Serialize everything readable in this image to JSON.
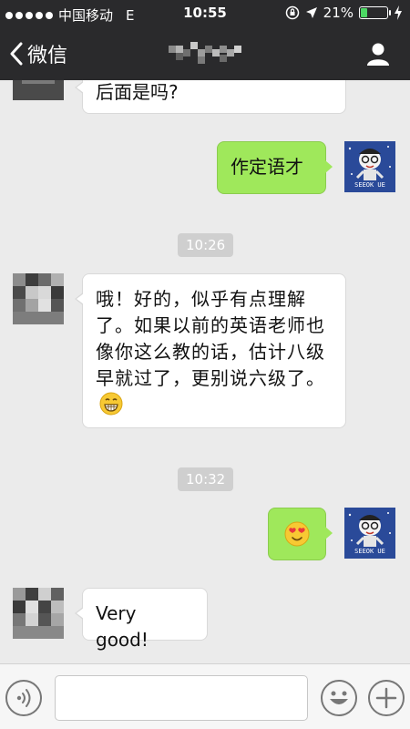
{
  "status_bar": {
    "carrier": "中国移动",
    "network": "E",
    "time": "10:55",
    "battery": "21%",
    "battery_level": 0.21,
    "signal_dots": 5
  },
  "nav": {
    "back_label": "微信",
    "title_note": "pixelated contact name",
    "icons": {
      "back": "chevron-left-icon",
      "profile": "person-icon"
    }
  },
  "messages": [
    {
      "side": "left",
      "text": "后面是吗?"
    },
    {
      "side": "right",
      "text": "作定语才"
    },
    {
      "type": "time",
      "text": "10:26"
    },
    {
      "side": "left",
      "text": "哦！好的，似乎有点理解了。如果以前的英语老师也像你这么教的话，估计八级早就过了，更别说六级了。",
      "emoji": "grin-emoji"
    },
    {
      "type": "time",
      "text": "10:32"
    },
    {
      "side": "right",
      "emoji": "heart-eyes-emoji"
    },
    {
      "side": "left",
      "text": "Very good!"
    }
  ],
  "avatar_text": "SEEOK UE",
  "input": {
    "placeholder": ""
  },
  "colors": {
    "nav_bg": "#2a2a2c",
    "bubble_green": "#9fe85b",
    "chat_bg": "#ebebeb",
    "time_badge": "#cfcfcf"
  }
}
